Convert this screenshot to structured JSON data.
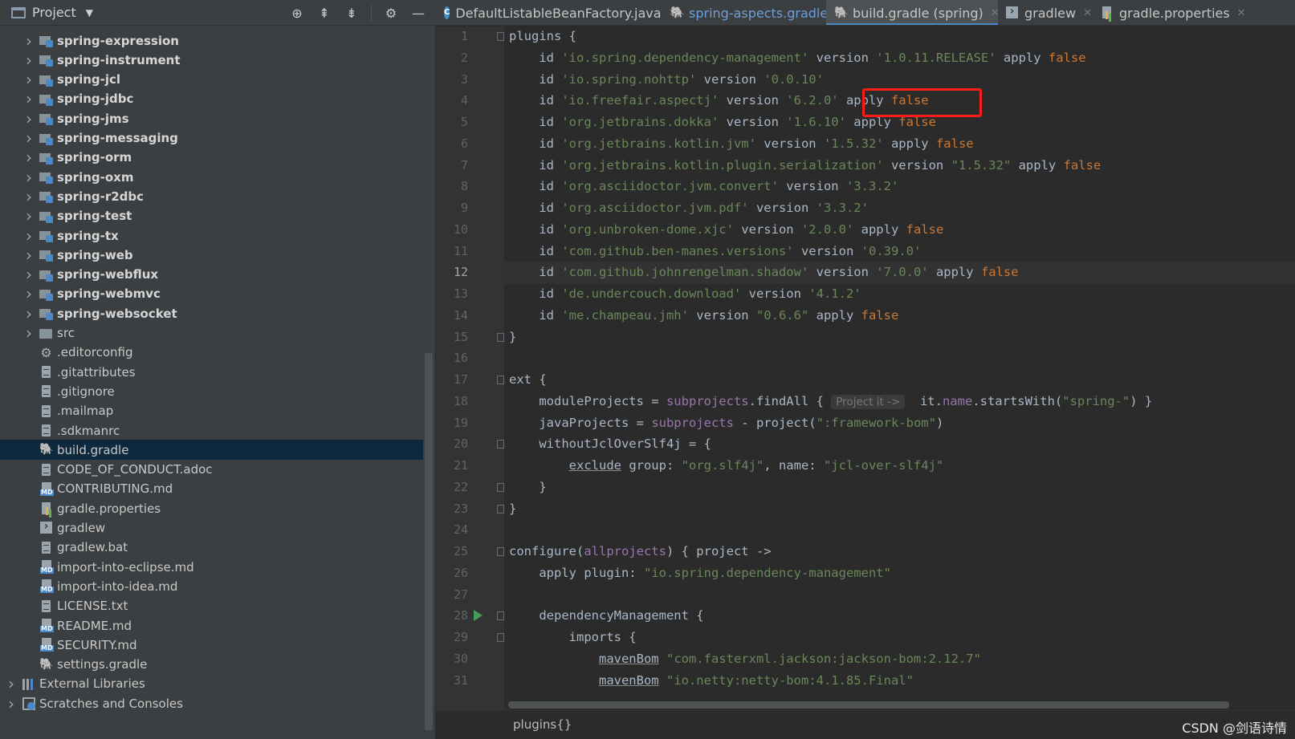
{
  "project_pane": {
    "title": "Project",
    "tools": [
      "locate-icon",
      "expand-all-icon",
      "collapse-all-icon",
      "gear-icon",
      "hide-icon"
    ]
  },
  "tree": [
    {
      "label": "spring-expression",
      "icon": "module",
      "expandable": true,
      "bold": true
    },
    {
      "label": "spring-instrument",
      "icon": "module",
      "expandable": true,
      "bold": true
    },
    {
      "label": "spring-jcl",
      "icon": "module",
      "expandable": true,
      "bold": true
    },
    {
      "label": "spring-jdbc",
      "icon": "module",
      "expandable": true,
      "bold": true
    },
    {
      "label": "spring-jms",
      "icon": "module",
      "expandable": true,
      "bold": true
    },
    {
      "label": "spring-messaging",
      "icon": "module",
      "expandable": true,
      "bold": true
    },
    {
      "label": "spring-orm",
      "icon": "module",
      "expandable": true,
      "bold": true
    },
    {
      "label": "spring-oxm",
      "icon": "module",
      "expandable": true,
      "bold": true
    },
    {
      "label": "spring-r2dbc",
      "icon": "module",
      "expandable": true,
      "bold": true
    },
    {
      "label": "spring-test",
      "icon": "module",
      "expandable": true,
      "bold": true
    },
    {
      "label": "spring-tx",
      "icon": "module",
      "expandable": true,
      "bold": true
    },
    {
      "label": "spring-web",
      "icon": "module",
      "expandable": true,
      "bold": true
    },
    {
      "label": "spring-webflux",
      "icon": "module",
      "expandable": true,
      "bold": true
    },
    {
      "label": "spring-webmvc",
      "icon": "module",
      "expandable": true,
      "bold": true
    },
    {
      "label": "spring-websocket",
      "icon": "module",
      "expandable": true,
      "bold": true
    },
    {
      "label": "src",
      "icon": "folder",
      "expandable": true,
      "bold": false
    },
    {
      "label": ".editorconfig",
      "icon": "gear",
      "expandable": false,
      "bold": false
    },
    {
      "label": ".gitattributes",
      "icon": "file",
      "expandable": false,
      "bold": false
    },
    {
      "label": ".gitignore",
      "icon": "file",
      "expandable": false,
      "bold": false
    },
    {
      "label": ".mailmap",
      "icon": "file",
      "expandable": false,
      "bold": false
    },
    {
      "label": ".sdkmanrc",
      "icon": "file",
      "expandable": false,
      "bold": false
    },
    {
      "label": "build.gradle",
      "icon": "gradle",
      "expandable": false,
      "bold": false,
      "selected": true
    },
    {
      "label": "CODE_OF_CONDUCT.adoc",
      "icon": "file",
      "expandable": false,
      "bold": false
    },
    {
      "label": "CONTRIBUTING.md",
      "icon": "md",
      "expandable": false,
      "bold": false
    },
    {
      "label": "gradle.properties",
      "icon": "props",
      "expandable": false,
      "bold": false
    },
    {
      "label": "gradlew",
      "icon": "term",
      "expandable": false,
      "bold": false
    },
    {
      "label": "gradlew.bat",
      "icon": "file",
      "expandable": false,
      "bold": false
    },
    {
      "label": "import-into-eclipse.md",
      "icon": "md",
      "expandable": false,
      "bold": false
    },
    {
      "label": "import-into-idea.md",
      "icon": "md",
      "expandable": false,
      "bold": false
    },
    {
      "label": "LICENSE.txt",
      "icon": "file",
      "expandable": false,
      "bold": false
    },
    {
      "label": "README.md",
      "icon": "md",
      "expandable": false,
      "bold": false
    },
    {
      "label": "SECURITY.md",
      "icon": "md",
      "expandable": false,
      "bold": false
    },
    {
      "label": "settings.gradle",
      "icon": "gradle",
      "expandable": false,
      "bold": false
    },
    {
      "label": "External Libraries",
      "icon": "libs",
      "expandable": true,
      "bold": false,
      "root": true
    },
    {
      "label": "Scratches and Consoles",
      "icon": "scratch",
      "expandable": true,
      "bold": false,
      "root": true
    }
  ],
  "tabs": [
    {
      "label": "DefaultListableBeanFactory.java",
      "icon": "class",
      "active": false
    },
    {
      "label": "spring-aspects.gradle",
      "icon": "gradle",
      "active": false
    },
    {
      "label": "build.gradle (spring)",
      "icon": "gradle",
      "active": true
    },
    {
      "label": "gradlew",
      "icon": "term",
      "active": false
    },
    {
      "label": "gradle.properties",
      "icon": "props",
      "active": false
    }
  ],
  "editor": {
    "current_line": 12,
    "lines": [
      [
        [
          "plain",
          "plugins {"
        ]
      ],
      [
        [
          "plain",
          "    id "
        ],
        [
          "str",
          "'io.spring.dependency-management'"
        ],
        [
          "plain",
          " version "
        ],
        [
          "str",
          "'1.0.11.RELEASE'"
        ],
        [
          "plain",
          " apply "
        ],
        [
          "kw",
          "false"
        ]
      ],
      [
        [
          "plain",
          "    id "
        ],
        [
          "str",
          "'io.spring.nohttp'"
        ],
        [
          "plain",
          " version "
        ],
        [
          "str",
          "'0.0.10'"
        ]
      ],
      [
        [
          "plain",
          "    id "
        ],
        [
          "str",
          "'io.freefair.aspectj'"
        ],
        [
          "plain",
          " version "
        ],
        [
          "str",
          "'6.2.0'"
        ],
        [
          "plain",
          " apply "
        ],
        [
          "kw",
          "false"
        ]
      ],
      [
        [
          "plain",
          "    id "
        ],
        [
          "str",
          "'org.jetbrains.dokka'"
        ],
        [
          "plain",
          " version "
        ],
        [
          "str",
          "'1.6.10'"
        ],
        [
          "plain",
          " apply "
        ],
        [
          "kw",
          "false"
        ]
      ],
      [
        [
          "plain",
          "    id "
        ],
        [
          "str",
          "'org.jetbrains.kotlin.jvm'"
        ],
        [
          "plain",
          " version "
        ],
        [
          "str",
          "'1.5.32'"
        ],
        [
          "plain",
          " apply "
        ],
        [
          "kw",
          "false"
        ]
      ],
      [
        [
          "plain",
          "    id "
        ],
        [
          "str",
          "'org.jetbrains.kotlin.plugin.serialization'"
        ],
        [
          "plain",
          " version "
        ],
        [
          "str",
          "\"1.5.32\""
        ],
        [
          "plain",
          " apply "
        ],
        [
          "kw",
          "false"
        ]
      ],
      [
        [
          "plain",
          "    id "
        ],
        [
          "str",
          "'org.asciidoctor.jvm.convert'"
        ],
        [
          "plain",
          " version "
        ],
        [
          "str",
          "'3.3.2'"
        ]
      ],
      [
        [
          "plain",
          "    id "
        ],
        [
          "str",
          "'org.asciidoctor.jvm.pdf'"
        ],
        [
          "plain",
          " version "
        ],
        [
          "str",
          "'3.3.2'"
        ]
      ],
      [
        [
          "plain",
          "    id "
        ],
        [
          "str",
          "'org.unbroken-dome.xjc'"
        ],
        [
          "plain",
          " version "
        ],
        [
          "str",
          "'2.0.0'"
        ],
        [
          "plain",
          " apply "
        ],
        [
          "kw",
          "false"
        ]
      ],
      [
        [
          "plain",
          "    id "
        ],
        [
          "str",
          "'com.github.ben-manes.versions'"
        ],
        [
          "plain",
          " version "
        ],
        [
          "str",
          "'0.39.0'"
        ]
      ],
      [
        [
          "plain",
          "    id "
        ],
        [
          "str",
          "'com.github.johnrengelman.shadow'"
        ],
        [
          "plain",
          " version "
        ],
        [
          "str",
          "'7.0.0'"
        ],
        [
          "plain",
          " apply "
        ],
        [
          "kw",
          "false"
        ]
      ],
      [
        [
          "plain",
          "    id "
        ],
        [
          "str",
          "'de.undercouch.download'"
        ],
        [
          "plain",
          " version "
        ],
        [
          "str",
          "'4.1.2'"
        ]
      ],
      [
        [
          "plain",
          "    id "
        ],
        [
          "str",
          "'me.champeau.jmh'"
        ],
        [
          "plain",
          " version "
        ],
        [
          "str",
          "\"0.6.6\""
        ],
        [
          "plain",
          " apply "
        ],
        [
          "kw",
          "false"
        ]
      ],
      [
        [
          "plain",
          "}"
        ]
      ],
      [
        [
          "plain",
          ""
        ]
      ],
      [
        [
          "plain",
          "ext {"
        ]
      ],
      [
        [
          "plain",
          "    moduleProjects = "
        ],
        [
          "prop",
          "subprojects"
        ],
        [
          "plain",
          ".findAll { "
        ],
        [
          "hint",
          "Project it ->"
        ],
        [
          "plain",
          "  it."
        ],
        [
          "prop",
          "name"
        ],
        [
          "plain",
          ".startsWith("
        ],
        [
          "str",
          "\"spring-\""
        ],
        [
          "plain",
          ") }"
        ]
      ],
      [
        [
          "plain",
          "    javaProjects = "
        ],
        [
          "prop",
          "subprojects"
        ],
        [
          "plain",
          " - project("
        ],
        [
          "str",
          "\":framework-bom\""
        ],
        [
          "plain",
          ")"
        ]
      ],
      [
        [
          "plain",
          "    withoutJclOverSlf4j = {"
        ]
      ],
      [
        [
          "plain",
          "        "
        ],
        [
          "ul",
          "exclude"
        ],
        [
          "plain",
          " group: "
        ],
        [
          "str",
          "\"org.slf4j\""
        ],
        [
          "plain",
          ", name: "
        ],
        [
          "str",
          "\"jcl-over-slf4j\""
        ]
      ],
      [
        [
          "plain",
          "    }"
        ]
      ],
      [
        [
          "plain",
          "}"
        ]
      ],
      [
        [
          "plain",
          ""
        ]
      ],
      [
        [
          "plain",
          "configure("
        ],
        [
          "prop",
          "allprojects"
        ],
        [
          "plain",
          ") { project ->"
        ]
      ],
      [
        [
          "plain",
          "    apply plugin: "
        ],
        [
          "str",
          "\"io.spring.dependency-management\""
        ]
      ],
      [
        [
          "plain",
          ""
        ]
      ],
      [
        [
          "plain",
          "    dependencyManagement {"
        ]
      ],
      [
        [
          "plain",
          "        imports {"
        ]
      ],
      [
        [
          "plain",
          "            "
        ],
        [
          "ul",
          "mavenBom"
        ],
        [
          "plain",
          " "
        ],
        [
          "str",
          "\"com.fasterxml.jackson:jackson-bom:2.12.7\""
        ]
      ],
      [
        [
          "plain",
          "            "
        ],
        [
          "ul",
          "mavenBom"
        ],
        [
          "plain",
          " "
        ],
        [
          "str",
          "\"io.netty:netty-bom:4.1.85.Final\""
        ]
      ]
    ],
    "fold_lines": [
      1,
      15,
      17,
      20,
      22,
      23,
      25,
      28,
      29
    ],
    "run_lines": [
      28
    ]
  },
  "breadcrumb": "plugins{}",
  "watermark": "CSDN @剑语诗情"
}
